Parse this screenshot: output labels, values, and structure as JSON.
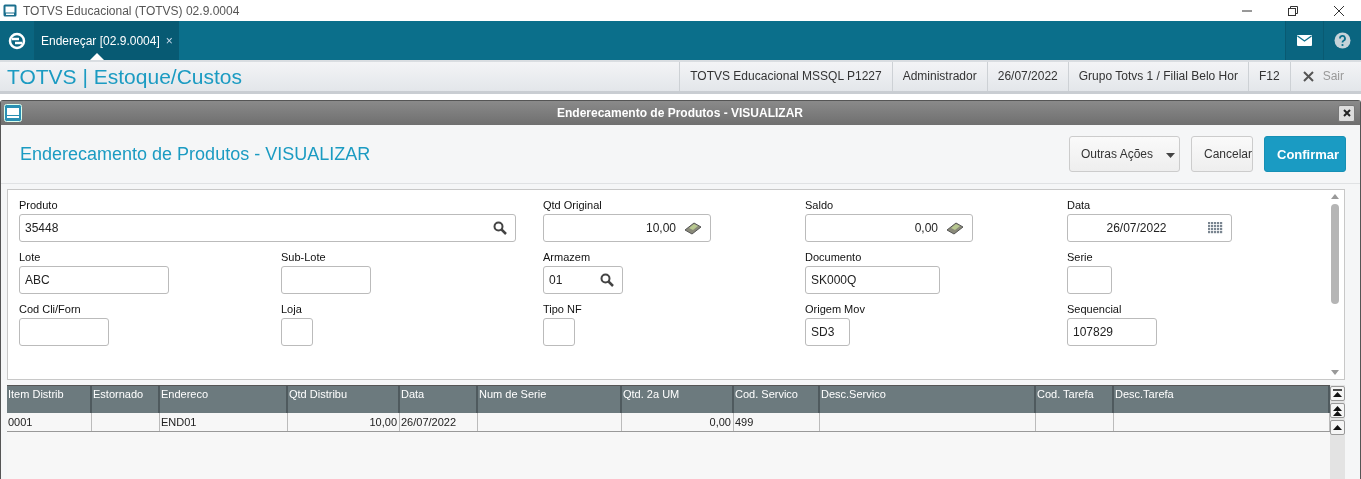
{
  "window": {
    "title": "TOTVS Educacional (TOTVS) 02.9.0004"
  },
  "tabs": [
    {
      "label": "Endereçar [02.9.0004]",
      "close": "×",
      "selected": true
    }
  ],
  "header": {
    "module": "TOTVS | Estoque/Custos",
    "info": [
      "TOTVS Educacional MSSQL P1227",
      "Administrador",
      "26/07/2022",
      "Grupo Totvs 1 / Filial Belo Hor",
      "F12"
    ],
    "exit": "Sair"
  },
  "dialog": {
    "title": "Enderecamento de Produtos - VISUALIZAR",
    "heading": "Enderecamento de Produtos - VISUALIZAR",
    "buttons": [
      {
        "label": "Outras Ações",
        "kind": "menu"
      },
      {
        "label": "Cancelar",
        "kind": "plain"
      },
      {
        "label": "Confirmar",
        "kind": "primary"
      }
    ]
  },
  "form": {
    "fields": [
      {
        "label": "Produto",
        "value": "35448",
        "kind": "lookup"
      },
      {
        "label": "Qtd Original",
        "value": "10,00",
        "kind": "amount"
      },
      {
        "label": "Saldo",
        "value": "0,00",
        "kind": "amount"
      },
      {
        "label": "Data",
        "value": "26/07/2022",
        "kind": "date"
      },
      {
        "label": "Lote",
        "value": "ABC",
        "kind": "text"
      },
      {
        "label": "Sub-Lote",
        "kind": "text"
      },
      {
        "label": "Armazem",
        "value": "01",
        "kind": "lookup"
      },
      {
        "label": "Documento",
        "value": "SK000Q",
        "kind": "text"
      },
      {
        "label": "Serie",
        "kind": "text"
      },
      {
        "label": "Cod Cli/Forn",
        "kind": "text"
      },
      {
        "label": "Loja",
        "kind": "text"
      },
      {
        "label": "Tipo NF",
        "kind": "text"
      },
      {
        "label": "Origem Mov",
        "value": "SD3",
        "kind": "text"
      },
      {
        "label": "Sequencial",
        "value": "107829",
        "kind": "text"
      }
    ]
  },
  "table": {
    "columns": [
      {
        "label": "Item Distrib",
        "kind": "text"
      },
      {
        "label": "Estornado",
        "kind": "text"
      },
      {
        "label": "Endereco",
        "kind": "text"
      },
      {
        "label": "Qtd Distribu",
        "kind": "number"
      },
      {
        "label": "Data",
        "kind": "text"
      },
      {
        "label": "Num de Serie",
        "kind": "text"
      },
      {
        "label": "Qtd. 2a UM",
        "kind": "number"
      },
      {
        "label": "Cod. Servico",
        "kind": "text"
      },
      {
        "label": "Desc.Servico",
        "kind": "text"
      },
      {
        "label": "Cod. Tarefa",
        "kind": "text"
      },
      {
        "label": "Desc.Tarefa",
        "kind": "text"
      }
    ],
    "rows": [
      [
        "0001",
        "",
        "END01",
        "10,00",
        "26/07/2022",
        "",
        "0,00",
        "499",
        "",
        "",
        ""
      ]
    ]
  }
}
